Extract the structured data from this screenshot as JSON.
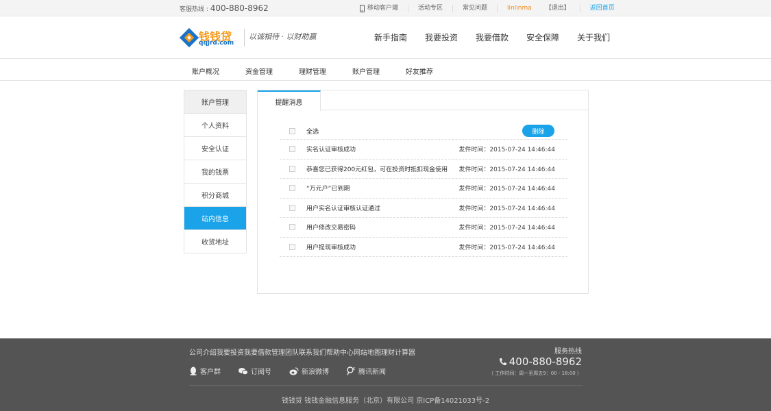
{
  "topbar": {
    "hotline_label": "客服热线 :",
    "hotline_number": "400-880-8962",
    "links": {
      "mobile": "移动客户端",
      "activity": "活动专区",
      "faq": "常见问题",
      "user": "linlinma",
      "logout": "【退出】",
      "home": "返回首页"
    }
  },
  "header": {
    "logo_text": "钱钱贷",
    "logo_domain": "qqjrd.com",
    "slogan": "以诚相待 · 以财助赢",
    "nav": [
      "新手指南",
      "我要投资",
      "我要借款",
      "安全保障",
      "关于我们"
    ]
  },
  "subnav": [
    "账户概况",
    "资金管理",
    "理财管理",
    "账户管理",
    "好友推荐"
  ],
  "sidebar": {
    "head": "账户管理",
    "items": [
      "个人资料",
      "安全认证",
      "我的钱票",
      "积分商城",
      "站内信息",
      "收货地址"
    ]
  },
  "panel": {
    "tab": "提醒消息",
    "select_all": "全选",
    "delete_label": "删除",
    "messages": [
      {
        "title": "实名认证审核成功",
        "time": "发件时间：2015-07-24 14:46:44"
      },
      {
        "title": "恭喜您已获得200元红包，可在投资时抵扣现金使用",
        "time": "发件时间：2015-07-24 14:46:44"
      },
      {
        "title": "“万元户”已到期",
        "time": "发件时间：2015-07-24 14:46:44"
      },
      {
        "title": "用户实名认证审核认证通过",
        "time": "发件时间：2015-07-24 14:46:44"
      },
      {
        "title": "用户修改交易密码",
        "time": "发件时间：2015-07-24 14:46:44"
      },
      {
        "title": "用户提现审核成功",
        "time": "发件时间：2015-07-24 14:46:44"
      }
    ]
  },
  "footer": {
    "links": [
      "公司介绍",
      "我要投资",
      "我要借款",
      "管理团队",
      "联系我们",
      "帮助中心",
      "网站地图",
      "理财计算器"
    ],
    "social": [
      "客户群",
      "订阅号",
      "新浪微博",
      "腾讯新闻"
    ],
    "service_label": "服务热线",
    "service_number": "400-880-8962",
    "service_time": "（ 工作时间：周一至周五9：00 - 18:00 ）",
    "copyright": "钱钱贷 钱钱金融信息服务（北京）有限公司 京ICP备14021033号-2"
  },
  "colors": {
    "accent": "#1aa3e8",
    "brand_orange": "#f59a1b",
    "footer_bg": "#545454"
  }
}
